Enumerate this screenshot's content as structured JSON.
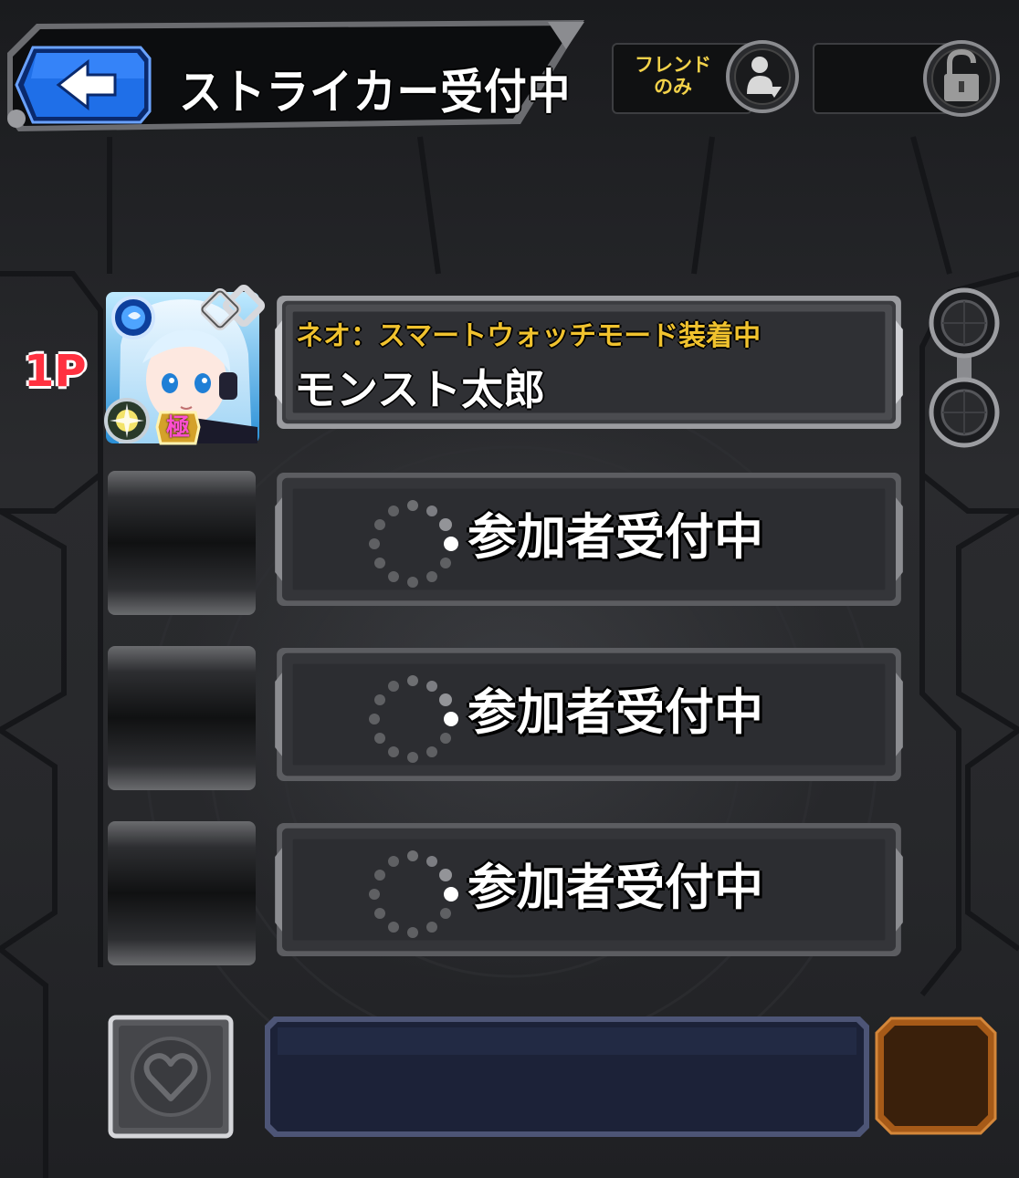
{
  "header": {
    "title": "ストライカー受付中",
    "back_icon": "back-arrow-icon",
    "friend_toggle_label": "フレンド\nのみ",
    "friend_icon": "friend-person-icon",
    "lock_icon": "padlock-icon"
  },
  "player1": {
    "slot_label": "1P",
    "status": "ネオ：スマートウォッチモード装着中",
    "name": "モンスト太郎",
    "element_badge": "water-element-icon",
    "skill_badge": "light-skill-icon",
    "rank_badge": "極",
    "chain_icon": "link-chain-icon"
  },
  "slots": [
    {
      "label": "参加者受付中",
      "spinner": "loading-spinner-icon"
    },
    {
      "label": "参加者受付中",
      "spinner": "loading-spinner-icon"
    },
    {
      "label": "参加者受付中",
      "spinner": "loading-spinner-icon"
    }
  ],
  "footer": {
    "heart_icon": "heart-icon"
  },
  "colors": {
    "accent_blue": "#1f6fe8",
    "status_gold": "#f0c22e",
    "player_red": "#ff3140",
    "chat_navy": "#1c2238",
    "orange": "#7a3f10"
  }
}
